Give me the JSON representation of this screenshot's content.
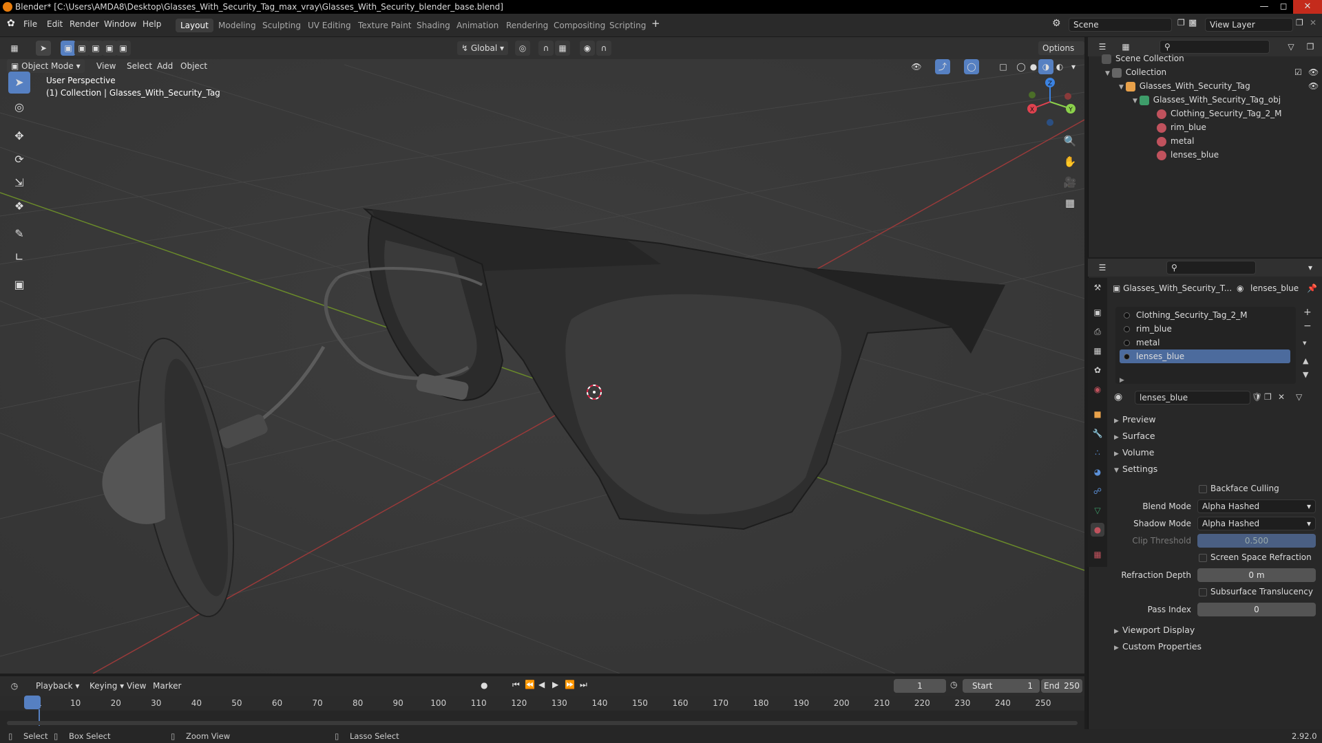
{
  "window": {
    "title": "Blender* [C:\\Users\\AMDA8\\Desktop\\Glasses_With_Security_Tag_max_vray\\Glasses_With_Security_blender_base.blend]"
  },
  "menu": {
    "items": [
      "File",
      "Edit",
      "Render",
      "Window",
      "Help"
    ],
    "workspaces": [
      "Layout",
      "Modeling",
      "Sculpting",
      "UV Editing",
      "Texture Paint",
      "Shading",
      "Animation",
      "Rendering",
      "Compositing",
      "Scripting"
    ],
    "active_workspace": "Layout",
    "scene_label": "Scene",
    "view_layer_label": "View Layer"
  },
  "viewport": {
    "mode": "Object Mode",
    "menus": [
      "View",
      "Select",
      "Add",
      "Object"
    ],
    "transform_orientation": "Global",
    "options_label": "Options",
    "info_line1": "User Perspective",
    "info_line2": "(1) Collection | Glasses_With_Security_Tag",
    "gizmo": {
      "x": "X",
      "y": "Y",
      "z": "Z"
    }
  },
  "outliner": {
    "scene_collection": "Scene Collection",
    "collection": "Collection",
    "object": "Glasses_With_Security_Tag",
    "mesh": "Glasses_With_Security_Tag_obj",
    "materials": [
      "Clothing_Security_Tag_2_M",
      "rim_blue",
      "metal",
      "lenses_blue"
    ]
  },
  "properties": {
    "object_name": "Glasses_With_Security_T...",
    "material_name": "lenses_blue",
    "slots": [
      "Clothing_Security_Tag_2_M",
      "rim_blue",
      "metal",
      "lenses_blue"
    ],
    "selected_slot": "lenses_blue",
    "material_field": "lenses_blue",
    "sections": {
      "preview": "Preview",
      "surface": "Surface",
      "volume": "Volume",
      "settings": "Settings",
      "viewport_display": "Viewport Display",
      "custom_properties": "Custom Properties"
    },
    "settings": {
      "backface_culling": "Backface Culling",
      "blend_mode_label": "Blend Mode",
      "blend_mode": "Alpha Hashed",
      "shadow_mode_label": "Shadow Mode",
      "shadow_mode": "Alpha Hashed",
      "clip_threshold_label": "Clip Threshold",
      "clip_threshold": "0.500",
      "screen_space_refraction": "Screen Space Refraction",
      "refraction_depth_label": "Refraction Depth",
      "refraction_depth": "0 m",
      "subsurface_translucency": "Subsurface Translucency",
      "pass_index_label": "Pass Index",
      "pass_index": "0"
    }
  },
  "timeline": {
    "menus": [
      "Playback",
      "Keying",
      "View",
      "Marker"
    ],
    "current_frame": "1",
    "start_label": "Start",
    "start": "1",
    "end_label": "End",
    "end": "250",
    "ticks": [
      "1",
      "10",
      "20",
      "30",
      "40",
      "50",
      "60",
      "70",
      "80",
      "90",
      "100",
      "110",
      "120",
      "130",
      "140",
      "150",
      "160",
      "170",
      "180",
      "190",
      "200",
      "210",
      "220",
      "230",
      "240",
      "250"
    ]
  },
  "statusbar": {
    "select": "Select",
    "box_select": "Box Select",
    "zoom_view": "Zoom View",
    "lasso_select": "Lasso Select",
    "version": "2.92.0"
  },
  "colors": {
    "accent": "#5680c2",
    "blender_orange": "#e87d0d",
    "axis_x": "#e0424f",
    "axis_y": "#8bd14b",
    "axis_z": "#3b83e3",
    "slot_selected": "#4c6b9d"
  }
}
